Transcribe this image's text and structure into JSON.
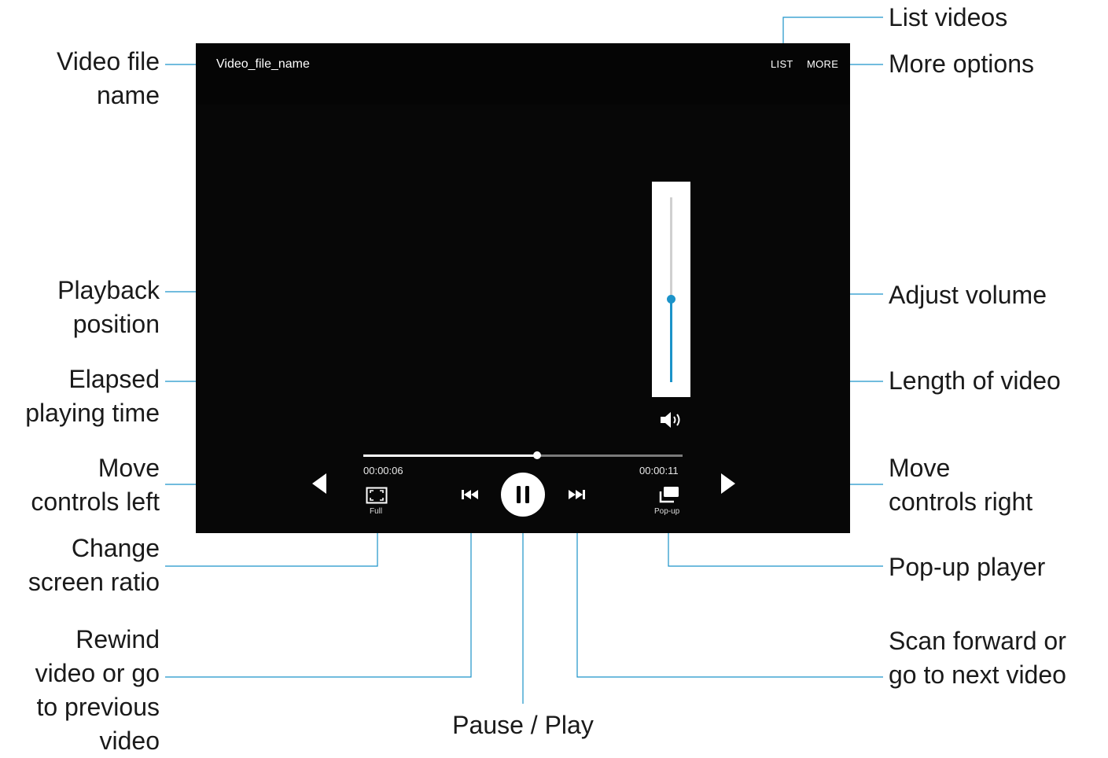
{
  "player": {
    "file_name": "Video_file_name",
    "list_label": "LIST",
    "more_label": "MORE",
    "elapsed_time": "00:00:06",
    "total_time": "00:00:11",
    "playback_position": 0.545,
    "volume_level": 0.45,
    "full_label": "Full",
    "popup_label": "Pop-up",
    "accent_color": "#1c93c9",
    "icons": [
      "expand-icon",
      "rewind-icon",
      "pause-icon",
      "fast-forward-icon",
      "popup-icon",
      "volume-icon",
      "arrow-left-icon",
      "arrow-right-icon"
    ]
  },
  "callouts": {
    "video_file_name": [
      "Video file",
      "name"
    ],
    "playback_position": [
      "Playback",
      "position"
    ],
    "elapsed_time": [
      "Elapsed",
      "playing time"
    ],
    "move_left": [
      "Move",
      "controls left"
    ],
    "change_ratio": [
      "Change",
      "screen ratio"
    ],
    "rewind": [
      "Rewind",
      "video or go",
      "to previous",
      "video"
    ],
    "pause_play": "Pause / Play",
    "list_videos": "List videos",
    "more_options": "More options",
    "adjust_volume": "Adjust volume",
    "length": "Length of video",
    "move_right": [
      "Move",
      "controls right"
    ],
    "popup_player": "Pop-up player",
    "scan_forward": [
      "Scan forward or",
      "go to next video"
    ]
  }
}
